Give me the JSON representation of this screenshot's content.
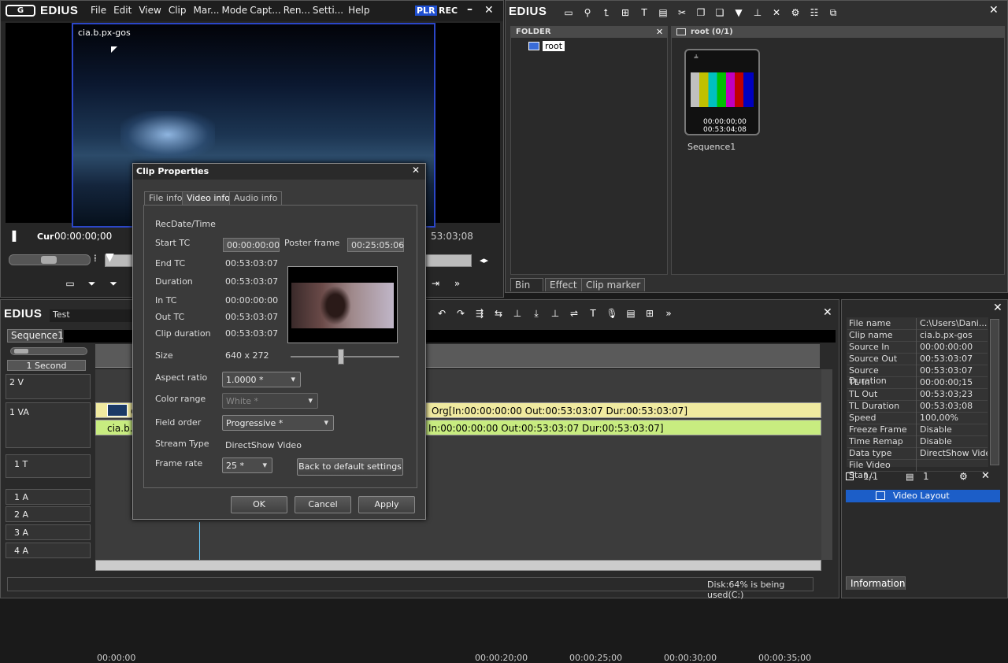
{
  "player": {
    "brand": "EDIUS",
    "menu": [
      "File",
      "Edit",
      "View",
      "Clip",
      "Mar...",
      "Mode",
      "Capt...",
      "Ren...",
      "Setti...",
      "Help"
    ],
    "plr": "PLR",
    "rec": "REC",
    "clip_overlay": "cia.b.px-gos",
    "cur_label": "Cur",
    "cur_tc": "00:00:00;00",
    "right_tc": "53:03;08"
  },
  "bin": {
    "brand": "EDIUS",
    "folder_header": "FOLDER",
    "root_tree": "root",
    "root_header": "root (0/1)",
    "thumb_tc1": "00:00:00;00",
    "thumb_tc2": "00:53:04;08",
    "thumb_name": "Sequence1",
    "tabs": [
      "Bin",
      "Effect",
      "Clip marker"
    ]
  },
  "timeline": {
    "brand": "EDIUS",
    "project": "Test",
    "sequence_tab": "Sequence1",
    "scale": "1 Second",
    "ruler": [
      "00:00:00",
      "00:00:20;00",
      "00:00:25;00",
      "00:00:30;00",
      "00:00:35;00"
    ],
    "tracks": [
      "2 V",
      "1 VA",
      "1 T",
      "1 A",
      "2 A",
      "3 A",
      "4 A"
    ],
    "clip_video_name": "c",
    "clip_audio_name": "cia.b.p",
    "clip_video_info": "Org[In:00:00:00:00 Out:00:53:03:07 Dur:00:53:03:07]",
    "clip_audio_info": "In:00:00:00:00 Out:00:53:03:07 Dur:00:53:03:07]",
    "status": "Disk:64% is being used(C:)"
  },
  "dialog": {
    "title": "Clip Properties",
    "tabs": [
      "File info",
      "Video info",
      "Audio info"
    ],
    "rec_date": "RecDate/Time",
    "start_tc_label": "Start TC",
    "start_tc": "00:00:00:00",
    "poster_label": "Poster frame",
    "poster_tc": "00:25:05:06",
    "end_tc_label": "End TC",
    "end_tc": "00:53:03:07",
    "duration_label": "Duration",
    "duration": "00:53:03:07",
    "in_tc_label": "In TC",
    "in_tc": "00:00:00:00",
    "out_tc_label": "Out TC",
    "out_tc": "00:53:03:07",
    "clip_duration_label": "Clip duration",
    "clip_duration": "00:53:03:07",
    "size_label": "Size",
    "size": "640 x 272",
    "aspect_label": "Aspect ratio",
    "aspect": "1.0000 *",
    "color_label": "Color range",
    "color": "White *",
    "field_label": "Field order",
    "field": "Progressive *",
    "stream_label": "Stream Type",
    "stream": "DirectShow Video",
    "frame_label": "Frame rate",
    "frame": "25 *",
    "default_btn": "Back to default settings",
    "ok": "OK",
    "cancel": "Cancel",
    "apply": "Apply"
  },
  "info": {
    "rows": [
      {
        "k": "File name",
        "v": "C:\\Users\\Dani..."
      },
      {
        "k": "Clip name",
        "v": "cia.b.px-gos"
      },
      {
        "k": "Source In",
        "v": "00:00:00:00"
      },
      {
        "k": "Source Out",
        "v": "00:53:03:07"
      },
      {
        "k": "Source Duration",
        "v": "00:53:03:07"
      },
      {
        "k": "TL In",
        "v": "00:00:00;15"
      },
      {
        "k": "TL Out",
        "v": "00:53:03;23"
      },
      {
        "k": "TL Duration",
        "v": "00:53:03;08"
      },
      {
        "k": "Speed",
        "v": "100,00%"
      },
      {
        "k": "Freeze Frame",
        "v": "Disable"
      },
      {
        "k": "Time Remap",
        "v": "Disable"
      },
      {
        "k": "Data type",
        "v": "DirectShow Video"
      },
      {
        "k": "File Video Stan...",
        "v": ""
      }
    ],
    "layer_count": "1/1",
    "filter_count": "1",
    "layout_item": "Video Layout",
    "tab": "Information"
  }
}
